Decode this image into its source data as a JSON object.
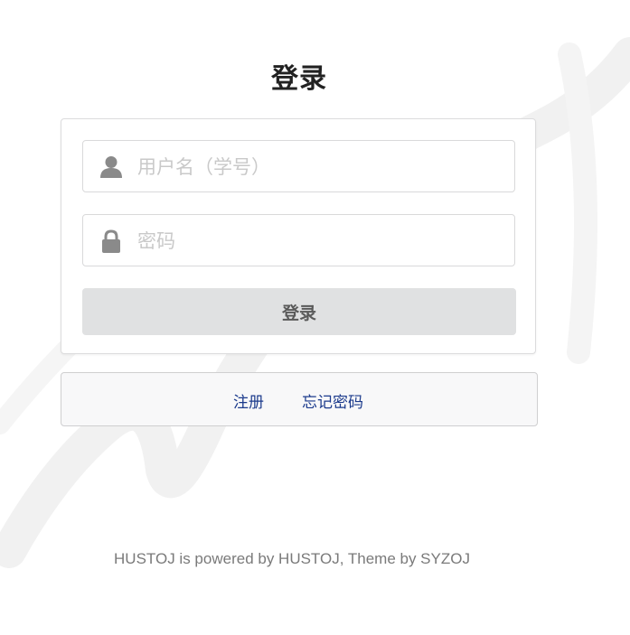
{
  "page": {
    "title": "登录"
  },
  "form": {
    "username_placeholder": "用户名（学号）",
    "username_value": "",
    "password_placeholder": "密码",
    "password_value": "",
    "submit_label": "登录"
  },
  "links": {
    "register_label": "注册",
    "forgot_label": "忘记密码"
  },
  "footer": {
    "text": "HUSTOJ is powered by HUSTOJ, Theme by SYZOJ"
  },
  "icons": {
    "username": "user-icon",
    "password": "lock-icon"
  },
  "colors": {
    "button_bg": "#e0e1e2",
    "link": "#1b3a8c",
    "icon": "#8a8a8a"
  }
}
